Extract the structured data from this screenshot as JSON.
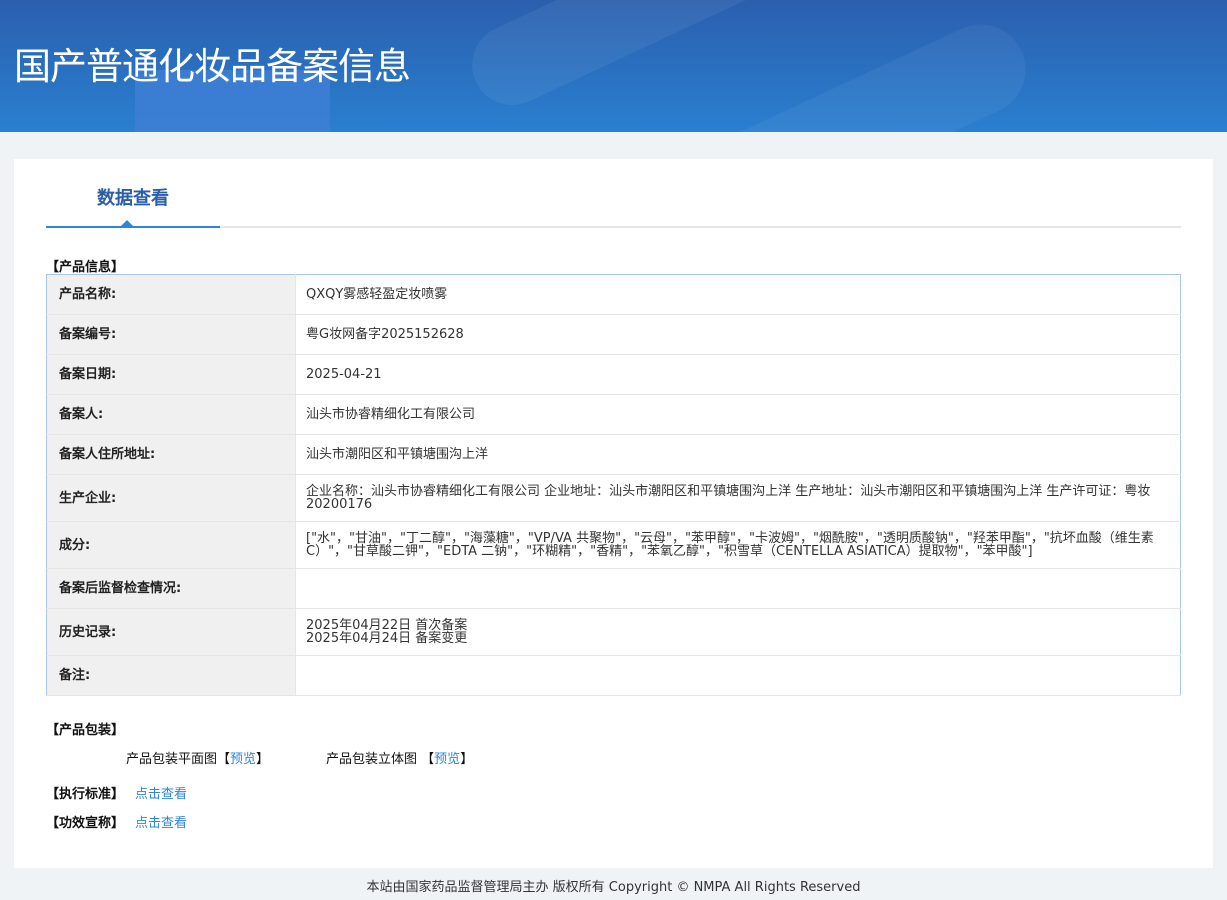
{
  "header": {
    "title": "国产普通化妆品备案信息"
  },
  "tab": {
    "label": "数据查看"
  },
  "product_info": {
    "section_title": "【产品信息】",
    "rows": [
      {
        "label": "产品名称:",
        "value": "QXQY雾感轻盈定妆喷雾"
      },
      {
        "label": "备案编号:",
        "value": "粤G妆网备字2025152628"
      },
      {
        "label": "备案日期:",
        "value": "2025-04-21"
      },
      {
        "label": "备案人:",
        "value": "汕头市协睿精细化工有限公司"
      },
      {
        "label": "备案人住所地址:",
        "value": "汕头市潮阳区和平镇塘围沟上洋"
      },
      {
        "label": "生产企业:",
        "value": "企业名称：汕头市协睿精细化工有限公司 企业地址：汕头市潮阳区和平镇塘围沟上洋 生产地址：汕头市潮阳区和平镇塘围沟上洋 生产许可证：粤妆20200176"
      },
      {
        "label": "成分:",
        "value": "[\"水\"，\"甘油\"，\"丁二醇\"，\"海藻糖\"，\"VP/VA 共聚物\"，\"云母\"，\"苯甲醇\"，\"卡波姆\"，\"烟酰胺\"，\"透明质酸钠\"，\"羟苯甲酯\"，\"抗坏血酸（维生素C）\"，\"甘草酸二钾\"，\"EDTA 二钠\"，\"环糊精\"，\"香精\"，\"苯氧乙醇\"，\"积雪草（CENTELLA ASIATICA）提取物\"，\"苯甲酸\"]"
      },
      {
        "label": "备案后监督检查情况:",
        "value": ""
      },
      {
        "label": "历史记录:",
        "value": "",
        "history": [
          "2025年04月22日 首次备案",
          "2025年04月24日 备案变更"
        ]
      },
      {
        "label": "备注:",
        "value": ""
      }
    ]
  },
  "packaging": {
    "section_title": "【产品包装】",
    "flat_label": "产品包装平面图",
    "flat_link": "预览",
    "solid_label": "产品包装立体图",
    "solid_link": "预览",
    "bracket_open": "【",
    "bracket_close": "】"
  },
  "standard": {
    "section_title": "【执行标准】",
    "link": "点击查看"
  },
  "efficacy": {
    "section_title": "【功效宣称】",
    "link": "点击查看"
  },
  "footer": {
    "text": "本站由国家药品监督管理局主办 版权所有 Copyright © NMPA All Rights Reserved"
  }
}
